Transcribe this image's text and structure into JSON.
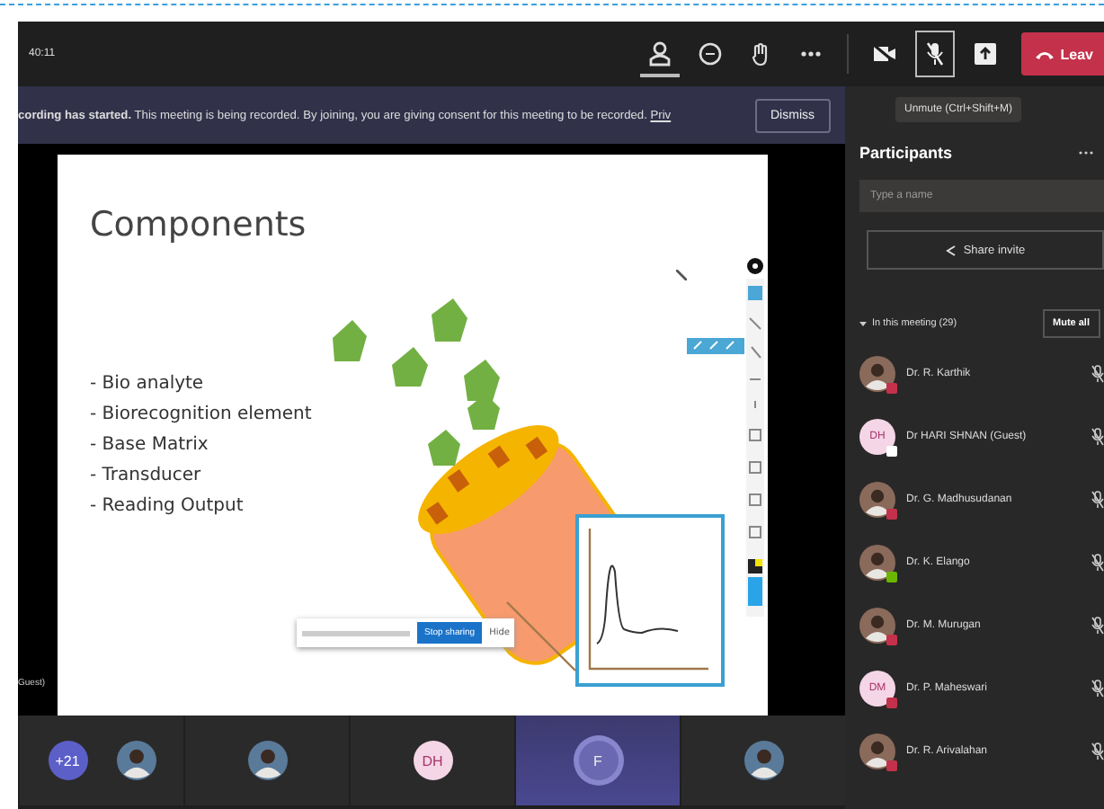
{
  "meeting_bar": {
    "timer": "40:11",
    "controls": [
      {
        "kind": "participants",
        "selected": true
      },
      {
        "kind": "chat",
        "selected": false
      },
      {
        "kind": "raise_hand",
        "selected": false
      },
      {
        "kind": "more",
        "selected": false
      },
      {
        "kind": "camera",
        "on": false
      },
      {
        "kind": "microphone",
        "muted": true,
        "focused": true
      },
      {
        "kind": "share",
        "selected": false
      }
    ],
    "leave": "Leav",
    "tooltip": "Unmute (Ctrl+Shift+M)"
  },
  "recording_banner": {
    "title": "cording has started.",
    "message": "This meeting is being recorded. By joining, you are giving consent for this meeting to be recorded.",
    "link": "Priv",
    "dismiss": "Dismiss"
  },
  "stage": {
    "name_label": "Guest)",
    "slide": {
      "title": "Components",
      "bullets": [
        "- Bio analyte",
        "- Biorecognition element",
        "- Base Matrix",
        "- Transducer",
        "- Reading Output"
      ]
    },
    "sharing_bar": {
      "stop": "Stop sharing",
      "hide": "Hide"
    }
  },
  "participants": {
    "title": "Participants",
    "search": {
      "placeholder": "Type a name"
    },
    "share_invite": "Share invite",
    "section": {
      "label": "In this meeting (29)",
      "expanded": true
    },
    "mute_all": "Mute all",
    "people": [
      {
        "name": "Dr. R. Karthik",
        "kind": "photo",
        "color": "#c4314b",
        "muted": true
      },
      {
        "name": "Dr HARI SHNAN (Guest)",
        "kind": "initials",
        "initials": "DH",
        "color": "#ffffff",
        "muted": true
      },
      {
        "name": "Dr. G. Madhusudanan",
        "kind": "photo",
        "color": "#c4314b",
        "muted": true
      },
      {
        "name": "Dr. K. Elango",
        "kind": "photo",
        "color": "#6bb700",
        "muted": true
      },
      {
        "name": "Dr. M. Murugan",
        "kind": "photo",
        "color": "#c4314b",
        "muted": true
      },
      {
        "name": "Dr. P. Maheswari",
        "kind": "initials",
        "initials": "DM",
        "color": "#c4314b",
        "muted": true
      },
      {
        "name": "Dr. R. Arivalahan",
        "kind": "photo",
        "color": "#c4314b",
        "muted": true
      }
    ]
  },
  "video_strip": [
    {
      "highlighted": false,
      "avatars": [
        {
          "kind": "count",
          "label": "+21"
        },
        {
          "kind": "photo"
        }
      ]
    },
    {
      "highlighted": false,
      "avatars": [
        {
          "kind": "photo"
        }
      ]
    },
    {
      "highlighted": false,
      "avatars": [
        {
          "kind": "initials",
          "label": "DH"
        }
      ]
    },
    {
      "highlighted": true,
      "avatars": [
        {
          "kind": "initials",
          "label": "F"
        }
      ]
    },
    {
      "highlighted": false,
      "avatars": [
        {
          "kind": "photo"
        }
      ]
    }
  ]
}
